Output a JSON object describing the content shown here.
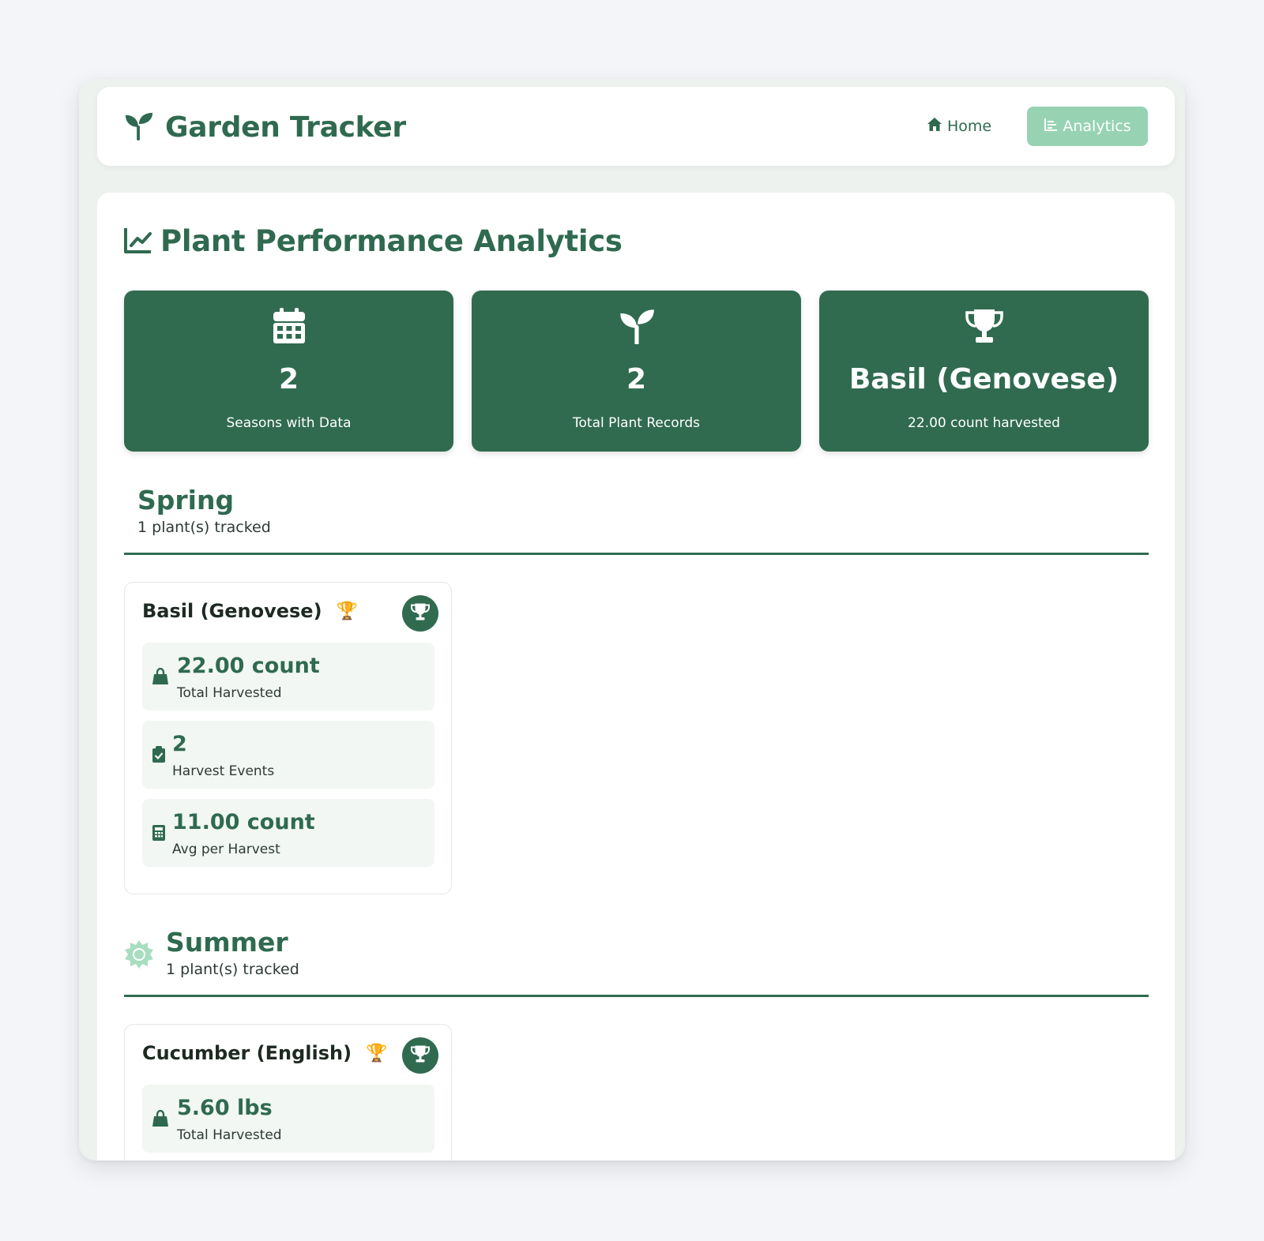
{
  "app": {
    "title": "Garden Tracker"
  },
  "nav": {
    "home_label": "Home",
    "analytics_label": "Analytics"
  },
  "page": {
    "title": "Plant Performance Analytics"
  },
  "stats": [
    {
      "icon": "calendar-icon",
      "value": "2",
      "label": "Seasons with Data"
    },
    {
      "icon": "seedling-icon",
      "value": "2",
      "label": "Total Plant Records"
    },
    {
      "icon": "trophy-icon",
      "value": "Basil (Genovese)",
      "label": "22.00 count harvested"
    }
  ],
  "seasons": [
    {
      "name": "Spring",
      "count": "1 plant(s) tracked",
      "plants": [
        {
          "name": "Basil (Genovese)",
          "trophy_emoji": "🏆",
          "metrics": [
            {
              "icon": "shopping-bag-icon",
              "value": "22.00 count",
              "label": "Total Harvested"
            },
            {
              "icon": "clipboard-check-icon",
              "value": "2",
              "label": "Harvest Events"
            },
            {
              "icon": "calculator-icon",
              "value": "11.00 count",
              "label": "Avg per Harvest"
            }
          ]
        }
      ]
    },
    {
      "name": "Summer",
      "icon": "sun-icon",
      "count": "1 plant(s) tracked",
      "plants": [
        {
          "name": "Cucumber (English)",
          "trophy_emoji": "🏆",
          "metrics": [
            {
              "icon": "shopping-bag-icon",
              "value": "5.60 lbs",
              "label": "Total Harvested"
            }
          ]
        }
      ]
    }
  ],
  "colors": {
    "primary": "#306b50",
    "accent_light": "#97d3b3",
    "metric_bg": "#f2f7f3",
    "background": "#f3f5f8"
  }
}
